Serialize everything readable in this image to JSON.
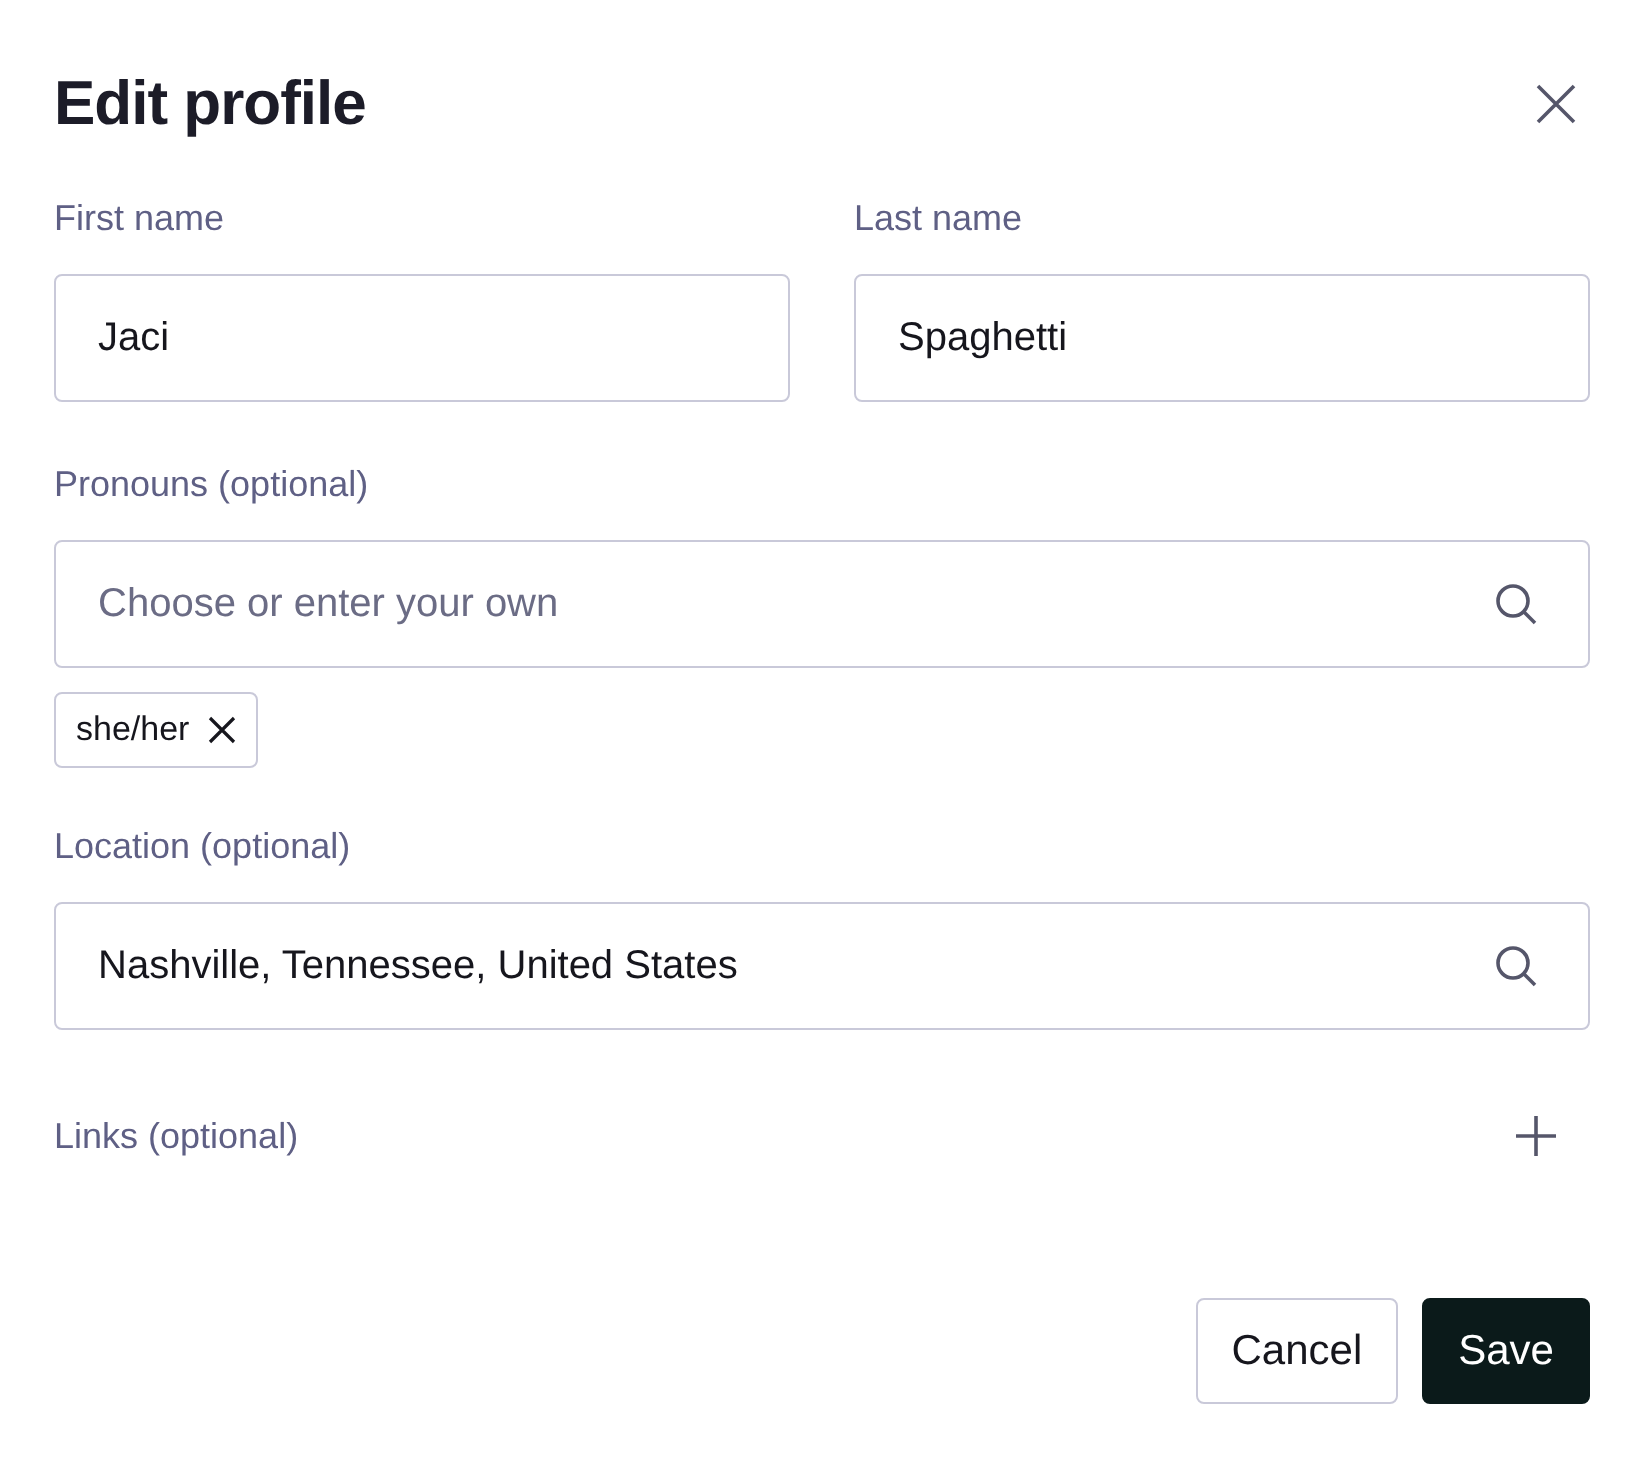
{
  "dialog": {
    "title": "Edit profile"
  },
  "name_fields": [
    {
      "label": "First name",
      "value": "Jaci"
    },
    {
      "label": "Last name",
      "value": "Spaghetti"
    }
  ],
  "pronouns": {
    "label": "Pronouns (optional)",
    "placeholder": "Choose or enter your own",
    "tags": [
      "she/her"
    ]
  },
  "location": {
    "label": "Location (optional)",
    "value": "Nashville, Tennessee, United States"
  },
  "links": {
    "label": "Links (optional)"
  },
  "buttons": [
    {
      "label": "Cancel",
      "kind": "secondary"
    },
    {
      "label": "Save",
      "kind": "primary"
    }
  ]
}
